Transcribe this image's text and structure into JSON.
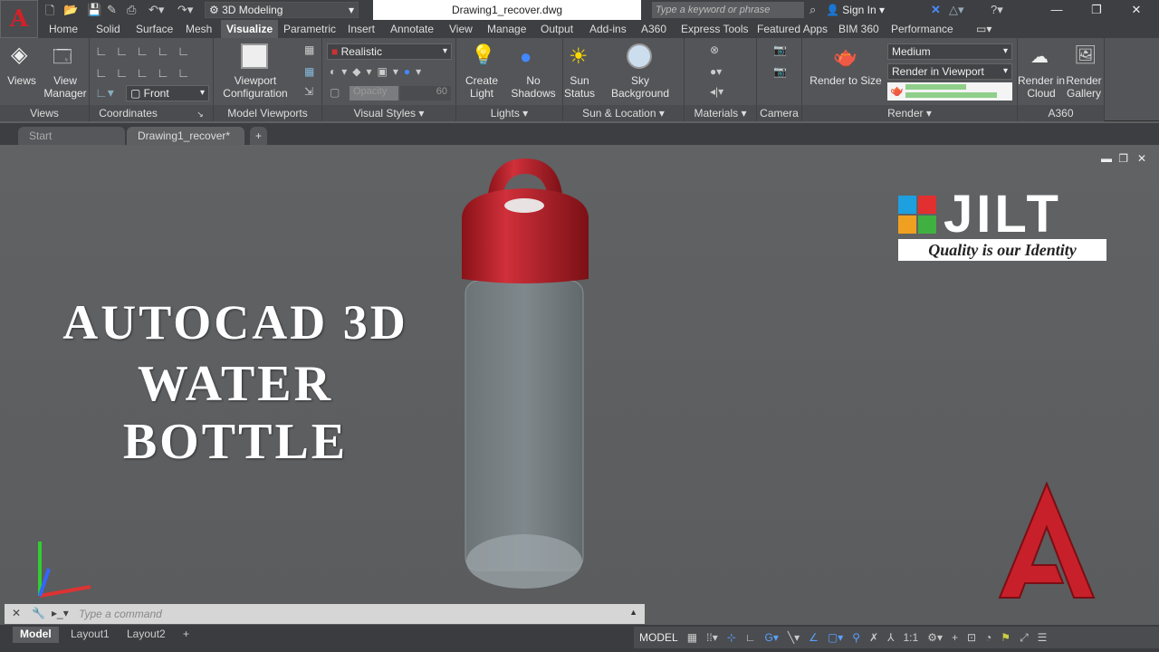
{
  "titlebar": {
    "workspace": "3D Modeling",
    "file": "Drawing1_recover.dwg",
    "search_placeholder": "Type a keyword or phrase",
    "sign_in": "Sign In"
  },
  "ribbon_tabs": [
    "Home",
    "Solid",
    "Surface",
    "Mesh",
    "Visualize",
    "Parametric",
    "Insert",
    "Annotate",
    "View",
    "Manage",
    "Output",
    "Add-ins",
    "A360",
    "Express Tools",
    "Featured Apps",
    "BIM 360",
    "Performance"
  ],
  "panels": {
    "views": {
      "title": "Views",
      "views": "Views",
      "view_manager": "View\nManager"
    },
    "coordinates": {
      "title": "Coordinates",
      "view_select": "Front"
    },
    "model_viewports": {
      "title": "Model Viewports",
      "viewport_config": "Viewport\nConfiguration"
    },
    "visual_styles": {
      "title": "Visual Styles",
      "style": "Realistic",
      "opacity_label": "Opacity",
      "opacity_value": "60"
    },
    "lights": {
      "title": "Lights",
      "create_light": "Create\nLight",
      "no_shadows": "No\nShadows"
    },
    "sun": {
      "title": "Sun & Location",
      "sun_status": "Sun\nStatus",
      "sky_background": "Sky Background"
    },
    "materials": {
      "title": "Materials"
    },
    "camera": {
      "title": "Camera"
    },
    "render": {
      "title": "Render",
      "render_to_size": "Render to Size",
      "quality": "Medium",
      "render_target": "Render in Viewport",
      "progress_1": 0.6,
      "progress_2": 0.9
    },
    "a360": {
      "title": "A360",
      "render_cloud": "Render in\nCloud",
      "render_gallery": "Render\nGallery"
    }
  },
  "doc_tabs": [
    "Start",
    "Drawing1_recover*"
  ],
  "viewport": {
    "title_line1": "AUTOCAD 3D",
    "title_line2": "WATER BOTTLE",
    "logo_text": "JILT",
    "logo_tagline": "Quality is our Identity"
  },
  "command": {
    "placeholder": "Type a command"
  },
  "layout_tabs": [
    "Model",
    "Layout1",
    "Layout2"
  ],
  "status": {
    "model": "MODEL",
    "scale": "1:1"
  },
  "colors": {
    "accent": "#d4202a",
    "bottle_cap": "#c0242c",
    "viewport_bg": "#5e6062"
  }
}
